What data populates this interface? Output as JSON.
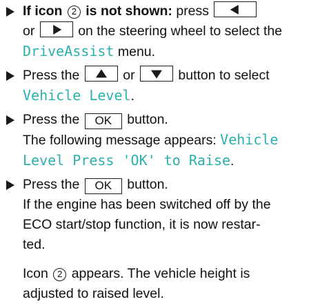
{
  "steps": [
    {
      "lead_bold": "If icon",
      "icon_num": "2",
      "lead_bold_end": "is not shown:",
      "text_a": "press",
      "key_a_icon": "triangle-left-icon",
      "text_b": "or",
      "key_b_icon": "triangle-right-icon",
      "text_c": "on the steering wheel to select the",
      "menu_name": "DriveAssist",
      "text_d": "menu."
    },
    {
      "text_a": "Press the",
      "key_a_icon": "triangle-up-icon",
      "text_b": "or",
      "key_b_icon": "triangle-down-icon",
      "text_c": "button to select",
      "menu_item": "Vehicle Level",
      "text_d": "."
    },
    {
      "text_a": "Press the",
      "key_label": "OK",
      "text_b": "button.",
      "message_intro": "The following message appears:",
      "message_line1": "Vehicle",
      "message_line2": "Level Press 'OK' to Raise",
      "message_end": "."
    },
    {
      "text_a": "Press the",
      "key_label": "OK",
      "text_b": "button.",
      "line2": "If the engine has been switched off by the",
      "line3": "ECO start/stop function, it is now restar-",
      "line4": "ted."
    }
  ],
  "note": {
    "text_a": "Icon",
    "icon_num": "2",
    "text_b": "appears. The vehicle height is",
    "line2": "adjusted to raised level."
  },
  "colors": {
    "display_text": "#2ab0ae",
    "body_text": "#111111"
  }
}
